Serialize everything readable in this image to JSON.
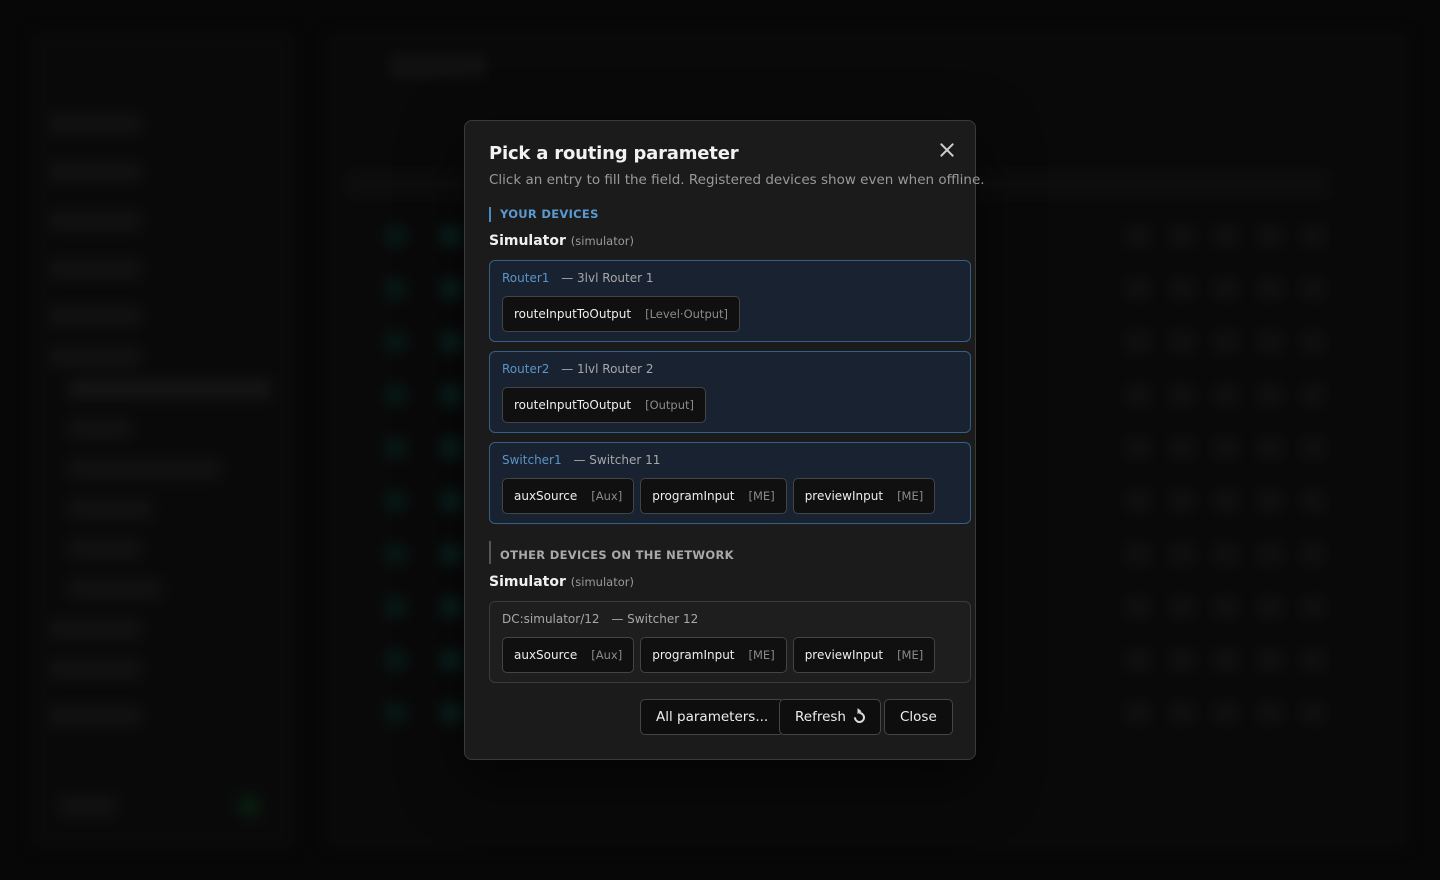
{
  "modal": {
    "title": "Pick a routing parameter",
    "subtitle": "Click an entry to fill the field. Registered devices show even when offline."
  },
  "sections": {
    "yours": {
      "label": "YOUR DEVICES",
      "group": {
        "name": "Simulator",
        "tag": "(simulator)"
      },
      "devices": [
        {
          "id": "Router1",
          "desc": "— 3lvl Router 1",
          "params": [
            {
              "name": "routeInputToOutput",
              "type": "[Level·Output]"
            }
          ]
        },
        {
          "id": "Router2",
          "desc": "— 1lvl Router 2",
          "params": [
            {
              "name": "routeInputToOutput",
              "type": "[Output]"
            }
          ]
        },
        {
          "id": "Switcher1",
          "desc": "— Switcher 11",
          "params": [
            {
              "name": "auxSource",
              "type": "[Aux]"
            },
            {
              "name": "programInput",
              "type": "[ME]"
            },
            {
              "name": "previewInput",
              "type": "[ME]"
            }
          ]
        }
      ]
    },
    "others": {
      "label": "OTHER DEVICES ON THE NETWORK",
      "group": {
        "name": "Simulator",
        "tag": "(simulator)"
      },
      "devices": [
        {
          "id": "DC:simulator/12",
          "desc": "— Switcher 12",
          "params": [
            {
              "name": "auxSource",
              "type": "[Aux]"
            },
            {
              "name": "programInput",
              "type": "[ME]"
            },
            {
              "name": "previewInput",
              "type": "[ME]"
            }
          ]
        }
      ]
    }
  },
  "footer": {
    "all_params_label": "All parameters...",
    "refresh_label": "Refresh",
    "close_label": "Close"
  },
  "icons": {
    "close": "close-icon",
    "refresh": "refresh-icon"
  },
  "colors": {
    "accent": "#5b94c6",
    "modal_bg": "#1b1b1b",
    "device_bg": "#182230"
  }
}
